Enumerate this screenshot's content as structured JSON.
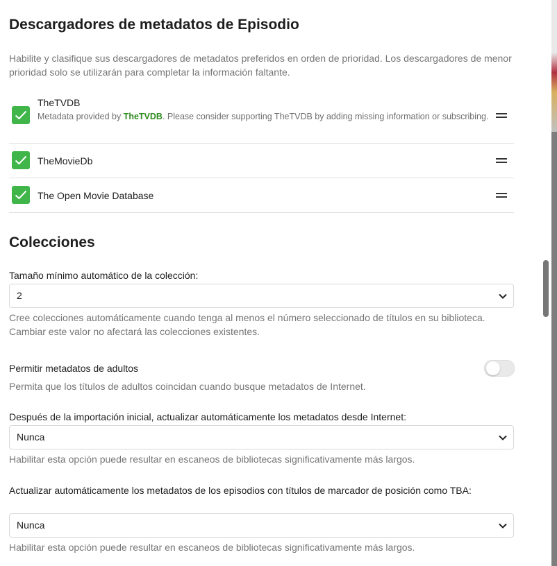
{
  "episode_fetchers": {
    "title": "Descargadores de metadatos de Episodio",
    "description": "Habilite y clasifique sus descargadores de metadatos preferidos en orden de prioridad. Los descargadores de menor prioridad solo se utilizarán para completar la información faltante.",
    "items": [
      {
        "name": "TheTVDB",
        "checked": true,
        "subtitle_pre": "Metadata provided by ",
        "subtitle_link": "TheTVDB",
        "subtitle_post": ". Please consider supporting TheTVDB by adding missing information or subscribing."
      },
      {
        "name": "TheMovieDb",
        "checked": true
      },
      {
        "name": "The Open Movie Database",
        "checked": true
      }
    ]
  },
  "collections": {
    "title": "Colecciones",
    "min_size_label": "Tamaño mínimo automático de la colección:",
    "min_size_value": "2",
    "min_size_help": "Cree colecciones automáticamente cuando tenga al menos el número seleccionado de títulos en su biblioteca. Cambiar este valor no afectará las colecciones existentes."
  },
  "adult_metadata": {
    "label": "Permitir metadatos de adultos",
    "help": "Permita que los títulos de adultos coincidan cuando busque metadatos de Internet.",
    "enabled": false
  },
  "refresh_after_import": {
    "label": "Después de la importación inicial, actualizar automáticamente los metadatos desde Internet:",
    "value": "Nunca",
    "help": "Habilitar esta opción puede resultar en escaneos de bibliotecas significativamente más largos."
  },
  "refresh_placeholder": {
    "label": "Actualizar automáticamente los metadatos de los episodios con títulos de marcador de posición como TBA:",
    "value": "Nunca",
    "help": "Habilitar esta opción puede resultar en escaneos de bibliotecas significativamente más largos."
  },
  "colors": {
    "check_green": "#3fb54a",
    "link_green": "#2e8b1f"
  },
  "icons": [
    "checkmark-icon",
    "drag-handle-icon",
    "chevron-down-icon"
  ]
}
